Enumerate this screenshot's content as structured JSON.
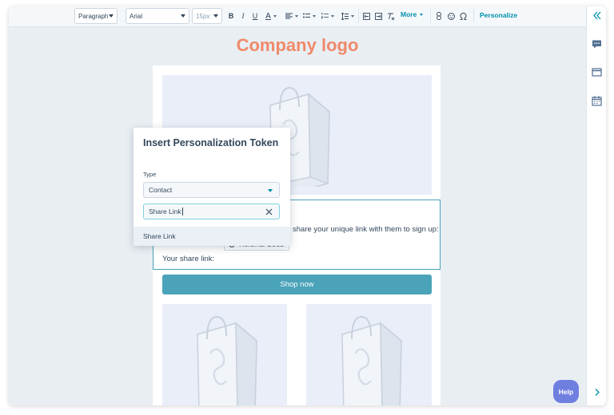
{
  "toolbar": {
    "paragraph_style": "Paragraph",
    "font_family": "Arial",
    "font_size": "15px",
    "bold": "B",
    "italic": "I",
    "underline": "U",
    "text_color": "A",
    "more_label": "More",
    "personalize_label": "Personalize",
    "icons": [
      "bold-icon",
      "italic-icon",
      "underline-icon",
      "text-color-icon",
      "align-icon",
      "bullet-list-icon",
      "numbered-list-icon",
      "line-height-icon",
      "indent-decrease-icon",
      "indent-increase-icon",
      "clear-format-icon",
      "link-icon",
      "emoji-icon",
      "special-character-icon"
    ]
  },
  "sidebar": {
    "icons": [
      "collapse-double-chevron-icon",
      "comment-icon",
      "layout-icon",
      "calendar-icon",
      "expand-chevron-icon"
    ]
  },
  "email": {
    "logo_text": "Company logo",
    "text_line1": "share your unique link with them to sign up:",
    "chip_label": "Referral Code",
    "share_link_label": "Your share link:",
    "shop_button": "Shop now"
  },
  "popover": {
    "title": "Insert Personalization Token",
    "type_label": "Type",
    "type_value": "Contact",
    "search_value": "Share Link",
    "result_item": "Share Link"
  },
  "help_label": "Help",
  "colors": {
    "accent": "#0091ae",
    "logo": "#ef8a6a",
    "button": "#4aa3b8",
    "help": "#6f7fe0",
    "text": "#33475b"
  }
}
